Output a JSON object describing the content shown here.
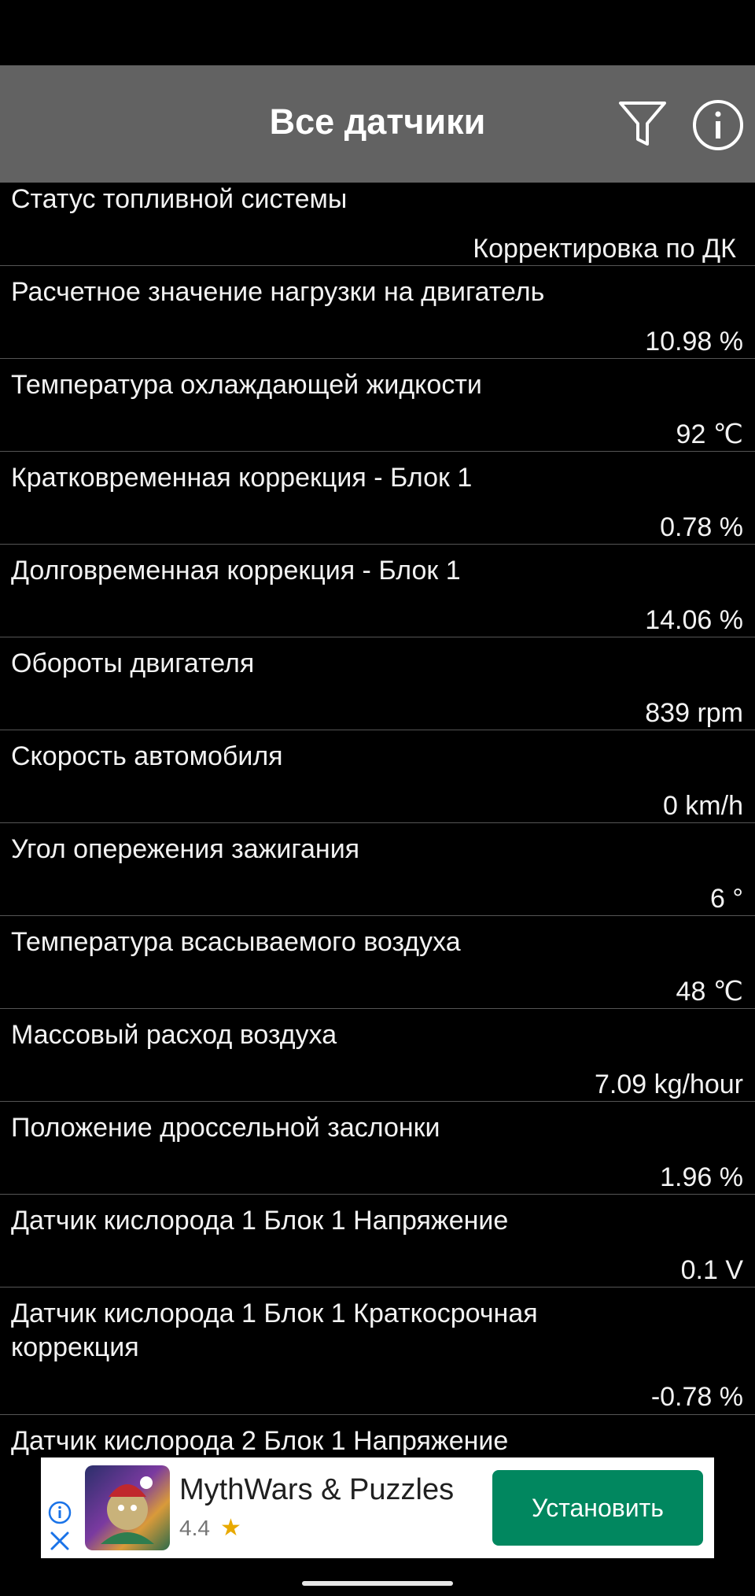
{
  "header": {
    "title": "Все датчики",
    "filter_icon": "funnel-filter-icon",
    "info_icon": "info-circle-icon"
  },
  "sensors": [
    {
      "label": "Статус топливной системы",
      "value": "Корректировка по ДК"
    },
    {
      "label": "Расчетное значение нагрузки на двигатель",
      "value": "10.98 %"
    },
    {
      "label": "Температура охлаждающей жидкости",
      "value": "92 ℃"
    },
    {
      "label": "Кратковременная коррекция - Блок 1",
      "value": "0.78 %"
    },
    {
      "label": "Долговременная коррекция - Блок 1",
      "value": "14.06 %"
    },
    {
      "label": "Обороты двигателя",
      "value": "839 rpm"
    },
    {
      "label": "Скорость автомобиля",
      "value": "0 km/h"
    },
    {
      "label": "Угол опережения зажигания",
      "value": "6 °"
    },
    {
      "label": "Температура всасываемого воздуха",
      "value": "48 ℃"
    },
    {
      "label": "Массовый расход воздуха",
      "value": "7.09 kg/hour"
    },
    {
      "label": "Положение дроссельной заслонки",
      "value": "1.96 %"
    },
    {
      "label": "Датчик кислорода 1 Блок 1 Напряжение",
      "value": "0.1 V"
    },
    {
      "label": "Датчик кислорода 1 Блок 1 Краткосрочная коррекция",
      "value": "-0.78 %"
    },
    {
      "label": "Датчик кислорода 2 Блок 1 Напряжение",
      "value": ""
    }
  ],
  "ad": {
    "app_name": "MythWars & Puzzles",
    "rating": "4.4",
    "install_label": "Установить",
    "info_icon": "ad-info-icon",
    "close_icon": "ad-close-icon"
  },
  "colors": {
    "background": "#000000",
    "appbar": "#626262",
    "install_button": "#01875f"
  }
}
